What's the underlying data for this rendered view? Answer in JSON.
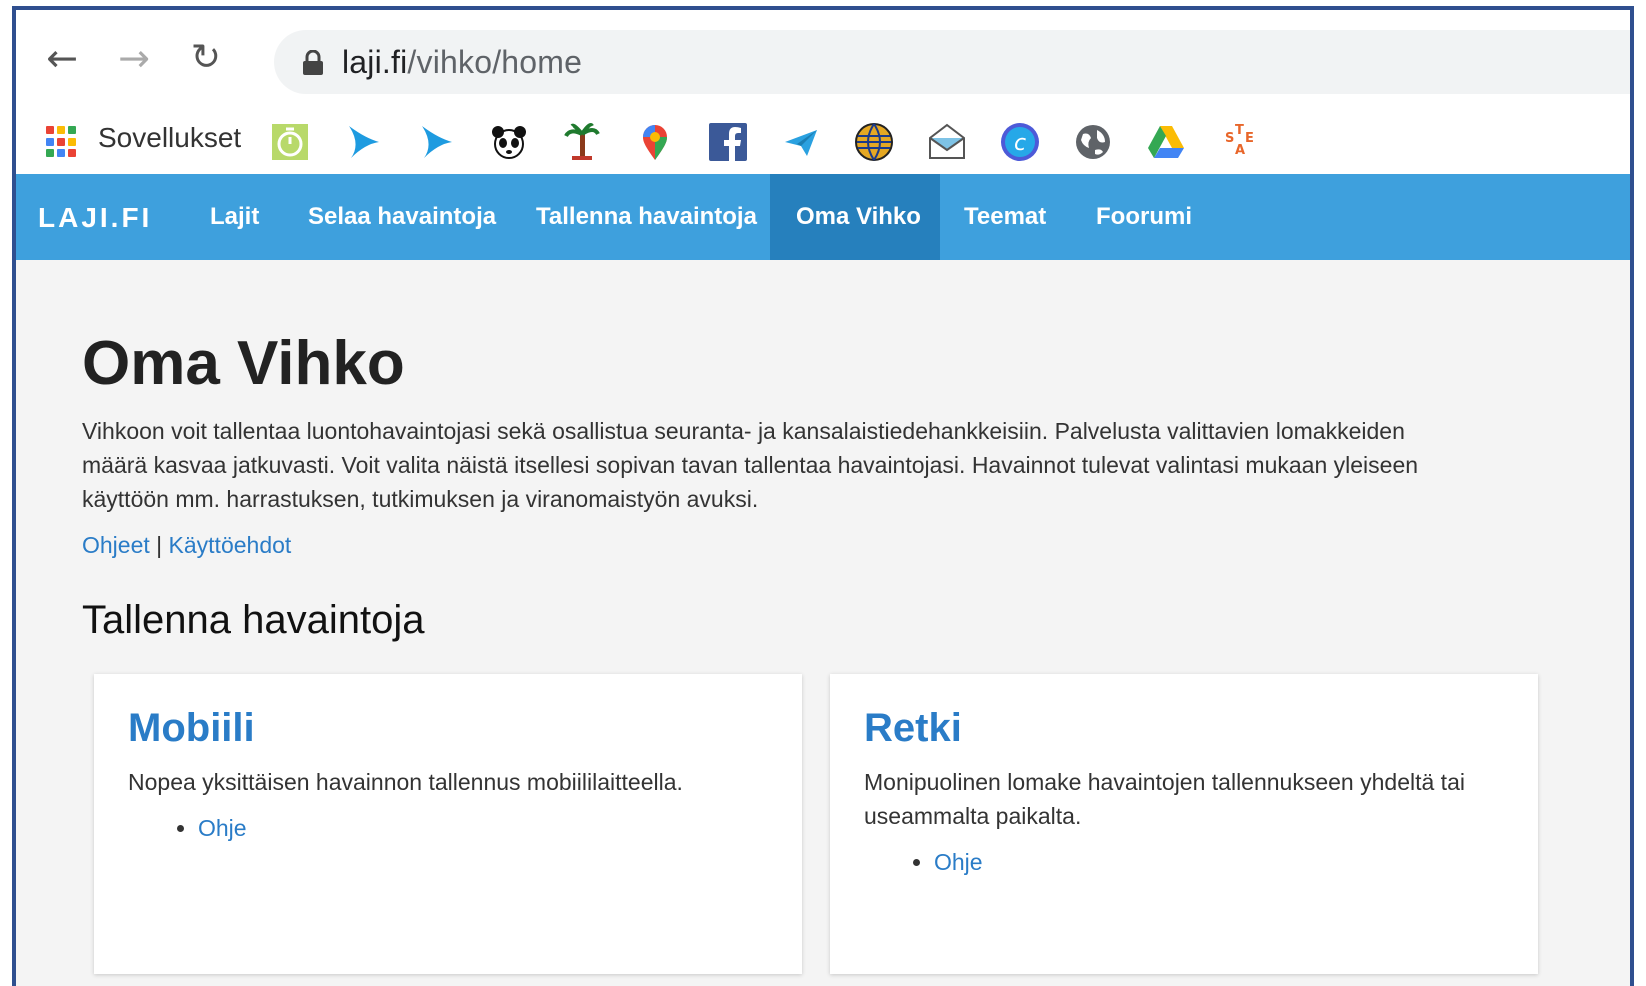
{
  "browser": {
    "url_host": "laji.fi",
    "url_path": "/vihko/home",
    "apps_label": "Sovellukset",
    "icons": {
      "back": "arrow-left-icon",
      "forward": "arrow-right-icon",
      "reload": "reload-icon",
      "lock": "lock-icon"
    }
  },
  "bookmarks": [
    "stopwatch-icon",
    "swift-bird-icon",
    "swift-bird-icon",
    "wwf-panda-icon",
    "palm-tree-icon",
    "maps-pin-icon",
    "facebook-icon",
    "paper-plane-icon",
    "globe-lines-icon",
    "envelope-icon",
    "c-circle-icon",
    "world-icon",
    "google-drive-icon",
    "state-logo-icon"
  ],
  "site": {
    "logo": "LAJI.FI",
    "nav": [
      {
        "label": "Lajit"
      },
      {
        "label": "Selaa havaintoja"
      },
      {
        "label": "Tallenna havaintoja"
      },
      {
        "label": "Oma Vihko",
        "active": true
      },
      {
        "label": "Teemat"
      },
      {
        "label": "Foorumi"
      }
    ],
    "colors": {
      "nav_bg": "#3ea0dd",
      "nav_active": "#2680bd",
      "link": "#2a7cc7"
    }
  },
  "page": {
    "title": "Oma Vihko",
    "intro": "Vihkoon voit tallentaa luontohavaintojasi sekä osallistua seuranta- ja kansalaistiedehankkeisiin. Palvelusta valittavien lomakkeiden määrä kasvaa jatkuvasti. Voit valita näistä itsellesi sopivan tavan tallentaa havaintojasi. Havainnot tulevat valintasi mukaan yleiseen käyttöön mm. harrastuksen, tutkimuksen ja viranomaistyön avuksi.",
    "link_help": "Ohjeet",
    "link_separator": "|",
    "link_terms": "Käyttöehdot",
    "section_title": "Tallenna havaintoja",
    "cards": [
      {
        "title": "Mobiili",
        "description": "Nopea yksittäisen havainnon tallennus mobiililaitteella.",
        "link": "Ohje"
      },
      {
        "title": "Retki",
        "description": "Monipuolinen lomake havaintojen tallennukseen yhdeltä tai useammalta paikalta.",
        "link": "Ohje"
      }
    ]
  }
}
